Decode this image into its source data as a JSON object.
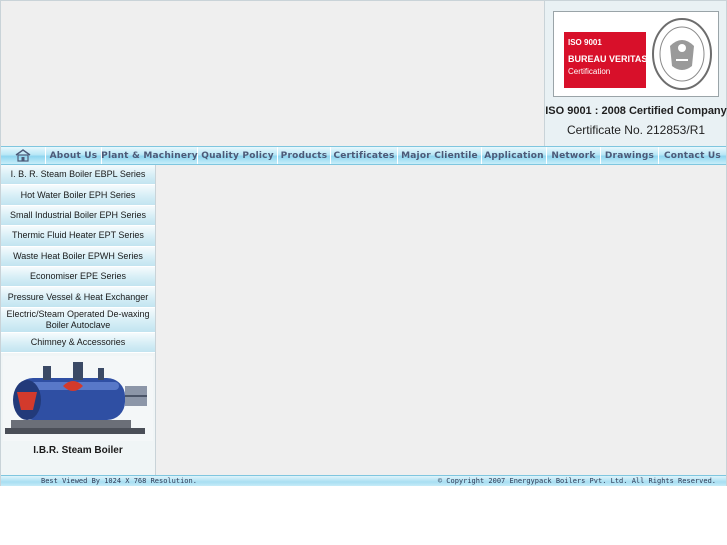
{
  "certificate": {
    "logo_iso": "ISO 9001",
    "logo_brand": "BUREAU VERITAS",
    "logo_certification": "Certification",
    "seal_text_top": "BUREAU VERITAS",
    "seal_year": "1828",
    "title": "ISO 9001 : 2008 Certified Company",
    "number": "Certificate No. 212853/R1"
  },
  "nav": {
    "home_icon": "home-icon",
    "items": [
      {
        "label": "About Us"
      },
      {
        "label": "Plant & Machinery"
      },
      {
        "label": "Quality Policy"
      },
      {
        "label": "Products"
      },
      {
        "label": "Certificates"
      },
      {
        "label": "Major Clientile"
      },
      {
        "label": "Application"
      },
      {
        "label": "Network"
      },
      {
        "label": "Drawings"
      },
      {
        "label": "Contact Us"
      }
    ]
  },
  "sidebar": {
    "items": [
      {
        "label": "I. B. R. Steam Boiler EBPL Series"
      },
      {
        "label": "Hot Water Boiler EPH Series"
      },
      {
        "label": "Small Industrial Boiler EPH Series"
      },
      {
        "label": "Thermic Fluid Heater EPT Series"
      },
      {
        "label": "Waste Heat Boiler EPWH Series"
      },
      {
        "label": "Economiser EPE Series"
      },
      {
        "label": "Pressure Vessel & Heat Exchanger"
      },
      {
        "label": "Electric/Steam Operated De-waxing Boiler Autoclave"
      },
      {
        "label": "Chimney & Accessories"
      }
    ],
    "image_caption": "I.B.R. Steam Boiler"
  },
  "footer": {
    "resolution": "Best Viewed By 1024 X 768 Resolution.",
    "copyright": "© Copyright 2007 Energypack Boilers Pvt. Ltd. All Rights Reserved."
  },
  "colors": {
    "accent_red": "#d8102a",
    "nav_text": "#4c5a78",
    "nav_bar": "#b9e7f6"
  }
}
